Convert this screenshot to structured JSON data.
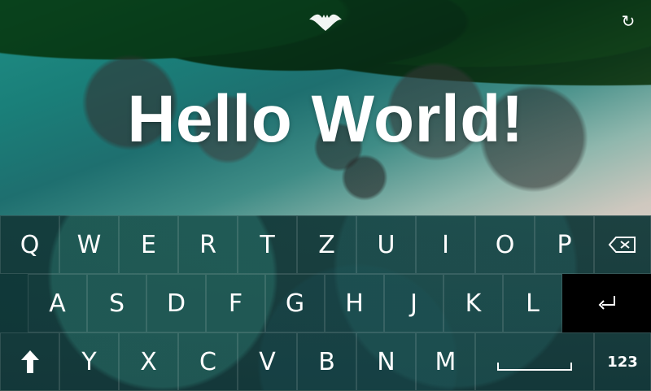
{
  "header": {
    "logo_icon": "bat-icon",
    "refresh_icon": "refresh-icon"
  },
  "hero": {
    "text": "Hello World!"
  },
  "keyboard": {
    "row1": [
      "Q",
      "W",
      "E",
      "R",
      "T",
      "Z",
      "U",
      "I",
      "O",
      "P"
    ],
    "row2": [
      "A",
      "S",
      "D",
      "F",
      "G",
      "H",
      "J",
      "K",
      "L"
    ],
    "row3": [
      "Y",
      "X",
      "C",
      "V",
      "B",
      "N",
      "M"
    ],
    "backspace_icon": "backspace-icon",
    "enter_icon": "enter-icon",
    "shift_icon": "shift-icon",
    "space_icon": "space-icon",
    "num_toggle_label": "123",
    "colors": {
      "key_text": "#ffffff",
      "enter_bg": "#000000"
    }
  }
}
